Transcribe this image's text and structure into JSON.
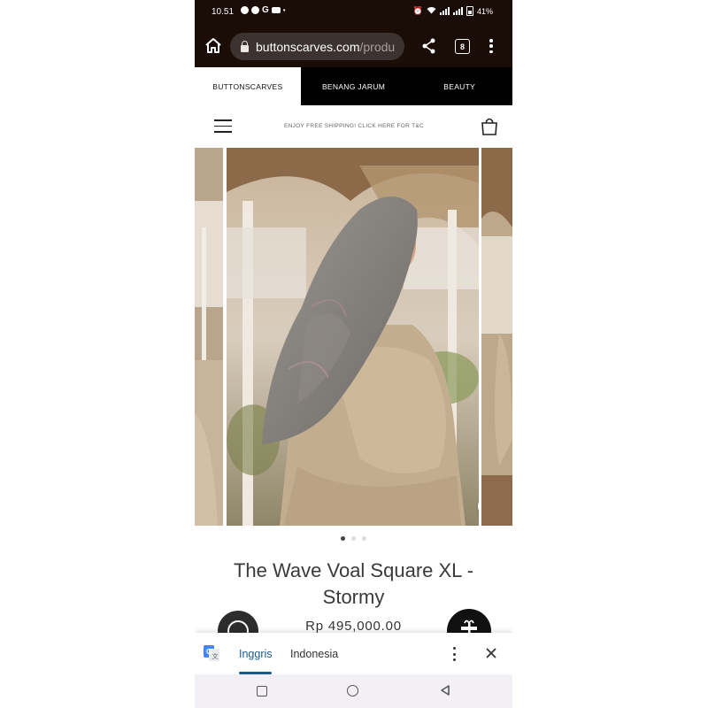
{
  "status_bar": {
    "time": "10.51",
    "battery": "41%",
    "notification_icons": [
      "whatsapp-icon",
      "messenger-icon",
      "google-icon",
      "youtube-icon"
    ]
  },
  "browser": {
    "url_host": "buttonscarves.com",
    "url_path": "/produ",
    "tab_count": "8"
  },
  "brand_tabs": [
    {
      "label": "BUTTONSCARVES",
      "active": true
    },
    {
      "label": "BENANG JARUM",
      "active": false
    },
    {
      "label": "BEAUTY",
      "active": false
    }
  ],
  "header": {
    "promo_text": "ENJOY FREE SHIPPING! CLICK HERE FOR T&C"
  },
  "carousel": {
    "active_index": 0,
    "count": 3
  },
  "product": {
    "title": "The Wave Voal Square XL - Stormy",
    "price": "Rp 495,000.00"
  },
  "translate_bar": {
    "selected_language": "Inggris",
    "other_language": "Indonesia"
  },
  "colors": {
    "browser_bar": "#1a0d08",
    "brand_tab_inactive": "#000000",
    "translate_accent": "#1a5b8c"
  }
}
